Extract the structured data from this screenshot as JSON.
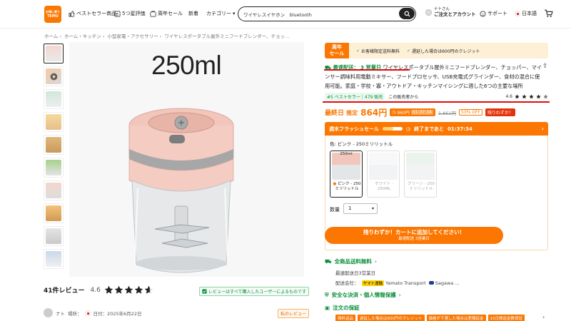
{
  "header": {
    "logo_line1": "お得に買う",
    "logo_line2": "TEMU",
    "nav": [
      "ベストセラー商品",
      "5つ星評価",
      "周年セール",
      "新着",
      "カテゴリー"
    ],
    "search_value": "ワイヤレスイヤホン　bluetooth",
    "account_line1": "ナトさん",
    "account_line2": "ご注文とアカウント",
    "support": "サポート",
    "language": "日本語"
  },
  "breadcrumb": [
    "ホーム",
    "ホーム・キッチン",
    "小型家電・アクセサリー",
    "ワイヤレスポータブル屋外ミニフードブレンダー、チョッ..."
  ],
  "image_caption": "250ml",
  "reviews": {
    "count_label": "41件レビュー",
    "score": "4.6",
    "verified_note": "レビューはすべて購入したユーザーによるものです",
    "reviewer_name": "ナト",
    "reviewer_meta": "場所：",
    "reviewer_date": "日付：2025年6月22日",
    "review_tag": "私のレビュー"
  },
  "promo": {
    "tag_line1": "周年",
    "tag_line2": "セール",
    "item1": "お客様限定送料無料",
    "item2": "遅延した場合は600円のクレジット"
  },
  "product": {
    "fast_label": "最速配送： 3 営業日",
    "title": "ワイヤレスポータブル屋外ミニフードブレンダー、チョッパー、マインサー調味料用電動ミキサー、フードプロセッサ、USB充電式グラインダー、食材の混合に使用可能。家庭・学校・寡・アウトドア・キッチンマイシングに適した6つの主要な場所",
    "best_badge": "#5 ベストセラー｜479 販売",
    "seller_note": "この販売者から",
    "rating": "4.6"
  },
  "price": {
    "label": "最終日",
    "estimate": "推定",
    "value": "864円",
    "coupon_amount": "960円",
    "coupon_timer": "01:37:34",
    "original": "1,851円",
    "discount": "53% OFF",
    "hurry": "残りわずか！"
  },
  "flash": {
    "title": "週末フラッシュセール",
    "ends": "終了まであと",
    "timer": "01:37:34",
    "progress": 0.55
  },
  "variants": {
    "label": "色: ピンク - 250ミリリットル",
    "items": [
      {
        "cap": "250ml",
        "label": "ピンク - 250ミリリットル"
      },
      {
        "cap": "",
        "label": "ホワイト - 250ML"
      },
      {
        "cap": "",
        "label": "グリーン - 250ミリリットル"
      }
    ]
  },
  "quantity": {
    "label": "数量",
    "value": "1"
  },
  "cta": {
    "main": "残りわずか！カートに追加してください！",
    "sub": "最速配送 3営業日"
  },
  "shipping": {
    "title": "全商品送料無料",
    "fast": "最速配送日3営業日",
    "partner_label": "配送会社：",
    "carrier1": "ヤマト運輸",
    "carrier2": "Yamato Transport",
    "carrier3": "Sagawa ..."
  },
  "safe": {
    "title": "安全な決済・個人情報保護"
  },
  "guarantee": {
    "title": "注文の保証",
    "tags": [
      "無料返品",
      "遅延した場合は600円のクレジット",
      "価格が下落した場合は差額返金",
      "15日間返金數保証"
    ]
  },
  "colors": {
    "accent": "#fb7701",
    "green": "#0a8f3c",
    "red": "#e30b0b"
  }
}
